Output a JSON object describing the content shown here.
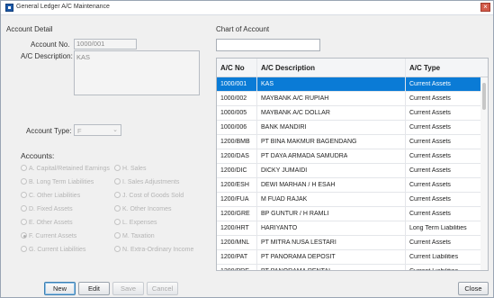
{
  "window": {
    "title": "General Ledger A/C Maintenance",
    "close_glyph": "×"
  },
  "account_detail": {
    "section_label": "Account Detail",
    "account_no_label": "Account No.",
    "account_no_value": "1000/001",
    "description_label": "A/C Description:",
    "description_value": "KAS",
    "account_type_label": "Account Type:",
    "account_type_value": "F",
    "accounts_label": "Accounts:",
    "radios_left": [
      "A. Capital/Retained Earnings",
      "B. Long Term Liabilities",
      "C. Other Liabilities",
      "D. Fixed Assets",
      "E. Other Assets",
      "F. Current Assets",
      "G. Current Liabilities"
    ],
    "radios_right": [
      "H. Sales",
      "I. Sales Adjustments",
      "J. Cost of Goods Sold",
      "K. Other Incomes",
      "L. Expenses",
      "M. Taxation",
      "N. Extra-Ordinary Income"
    ],
    "selected_radio": "F. Current Assets"
  },
  "buttons": {
    "new": "New",
    "edit": "Edit",
    "save": "Save",
    "cancel": "Cancel",
    "close": "Close"
  },
  "chart_of_account": {
    "section_label": "Chart of Account",
    "search_value": "",
    "columns": [
      "A/C No",
      "A/C Description",
      "A/C Type"
    ],
    "rows": [
      [
        "1000/001",
        "KAS",
        "Current Assets"
      ],
      [
        "1000/002",
        "MAYBANK A/C RUPIAH",
        "Current Assets"
      ],
      [
        "1000/005",
        "MAYBANK A/C DOLLAR",
        "Current Assets"
      ],
      [
        "1000/006",
        "BANK MANDIRI",
        "Current Assets"
      ],
      [
        "1200/BMB",
        "PT BINA MAKMUR BAGENDANG",
        "Current Assets"
      ],
      [
        "1200/DAS",
        "PT DAYA ARMADA SAMUDRA",
        "Current Assets"
      ],
      [
        "1200/DIC",
        "DICKY JUMAIDI",
        "Current Assets"
      ],
      [
        "1200/ESH",
        "DEWI MARHAN / H ESAH",
        "Current Assets"
      ],
      [
        "1200/FUA",
        "M FUAD RAJAK",
        "Current Assets"
      ],
      [
        "1200/GRE",
        "BP GUNTUR / H RAMLI",
        "Current Assets"
      ],
      [
        "1200/HRT",
        "HARIYANTO",
        "Long Term Liabilities"
      ],
      [
        "1200/MNL",
        "PT MITRA NUSA LESTARI",
        "Current Assets"
      ],
      [
        "1200/PAT",
        "PT PANORAMA DEPOSIT",
        "Current Liabilities"
      ],
      [
        "1200/PRE",
        "PT PANORAMA RENTAL",
        "Current Liabilities"
      ],
      [
        "1200/RBM",
        "PT RAMBAH BINA MAKMUR",
        "Current Assets"
      ]
    ],
    "selected_row": 0
  }
}
